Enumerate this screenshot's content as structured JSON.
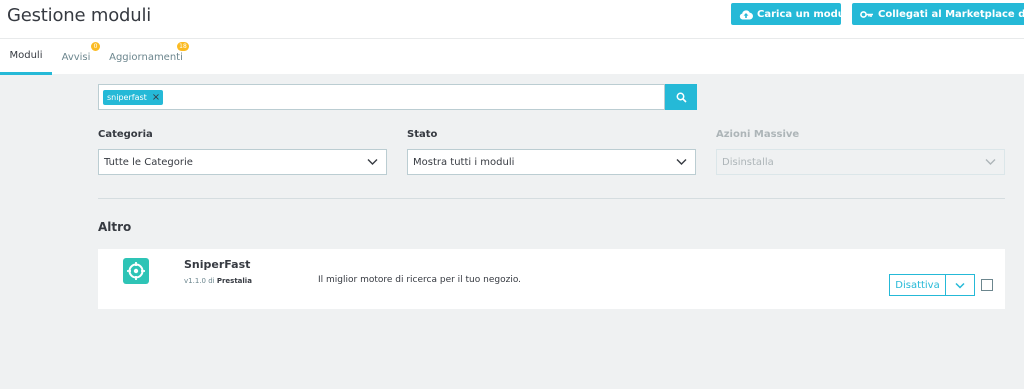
{
  "header": {
    "title": "Gestione moduli",
    "upload_label": "Carica un modulo",
    "marketplace_label": "Collegati al Marketplace degli Addons"
  },
  "tabs": [
    {
      "label": "Moduli",
      "active": true
    },
    {
      "label": "Avvisi",
      "badge": "0"
    },
    {
      "label": "Aggiornamenti",
      "badge": "18"
    }
  ],
  "search": {
    "tag": "sniperfast",
    "icon": "search-icon"
  },
  "filters": {
    "categoria": {
      "label": "Categoria",
      "value": "Tutte le Categorie"
    },
    "stato": {
      "label": "Stato",
      "value": "Mostra tutti i moduli"
    },
    "azioni": {
      "label": "Azioni Massive",
      "value": "Disinstalla",
      "disabled": true
    }
  },
  "section": {
    "title": "Altro"
  },
  "module": {
    "name": "SniperFast",
    "version": "v1.1.0",
    "by": "di",
    "author": "Prestalia",
    "description": "Il miglior motore di ricerca per il tuo negozio.",
    "action_label": "Disattiva"
  },
  "colors": {
    "accent": "#25b9d7",
    "badge": "#fbbb22",
    "logo": "#2ec4b6"
  }
}
